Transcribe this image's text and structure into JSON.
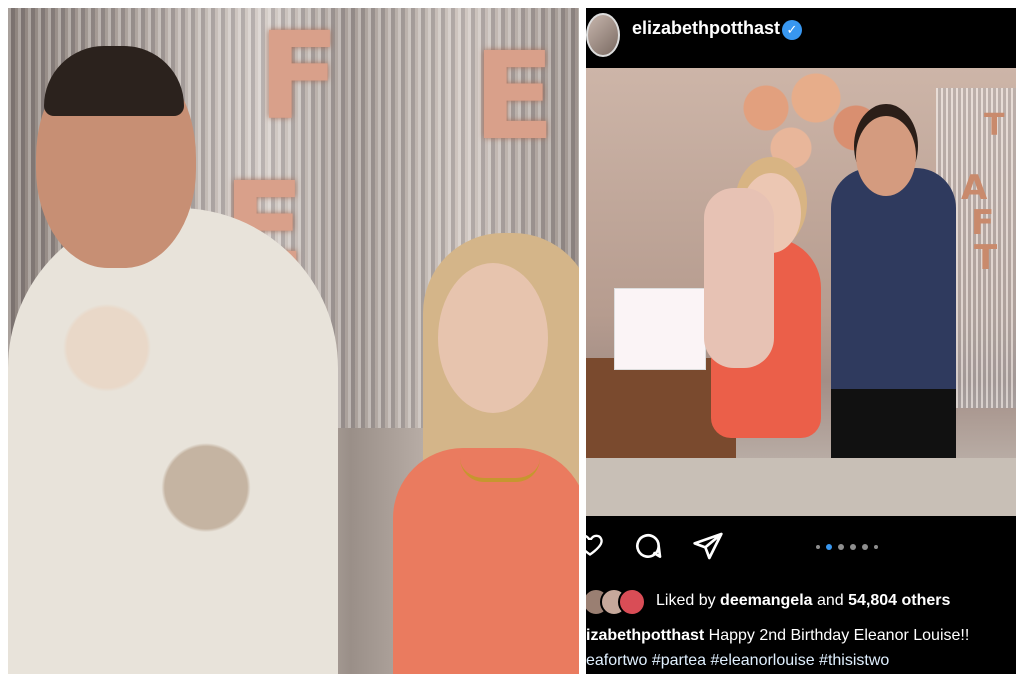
{
  "post": {
    "username": "elizabethpotthast",
    "verified": true,
    "likes": {
      "prefix": "Liked by",
      "user": "deemangela",
      "joiner": "and",
      "count_text": "54,804 others"
    },
    "caption": {
      "username_visible": "izabethpotthast",
      "text": "Happy 2nd Birthday Eleanor Louise!!"
    },
    "hashtags_visible": "eafortwo #partea #eleanorlouise #thisistwo",
    "carousel": {
      "total_dots": 6,
      "active_index": 1
    },
    "balloon_letters_right": [
      "T",
      "E",
      "A",
      "F",
      "T"
    ]
  },
  "left_photo": {
    "balloon_letters": [
      "F",
      "E",
      "E"
    ]
  },
  "icons": {
    "like": "heart-icon",
    "comment": "comment-icon",
    "share": "share-icon",
    "verified": "verified-badge-icon"
  },
  "colors": {
    "accent": "#3897f0",
    "background_dark": "#000000",
    "text": "#ffffff"
  }
}
